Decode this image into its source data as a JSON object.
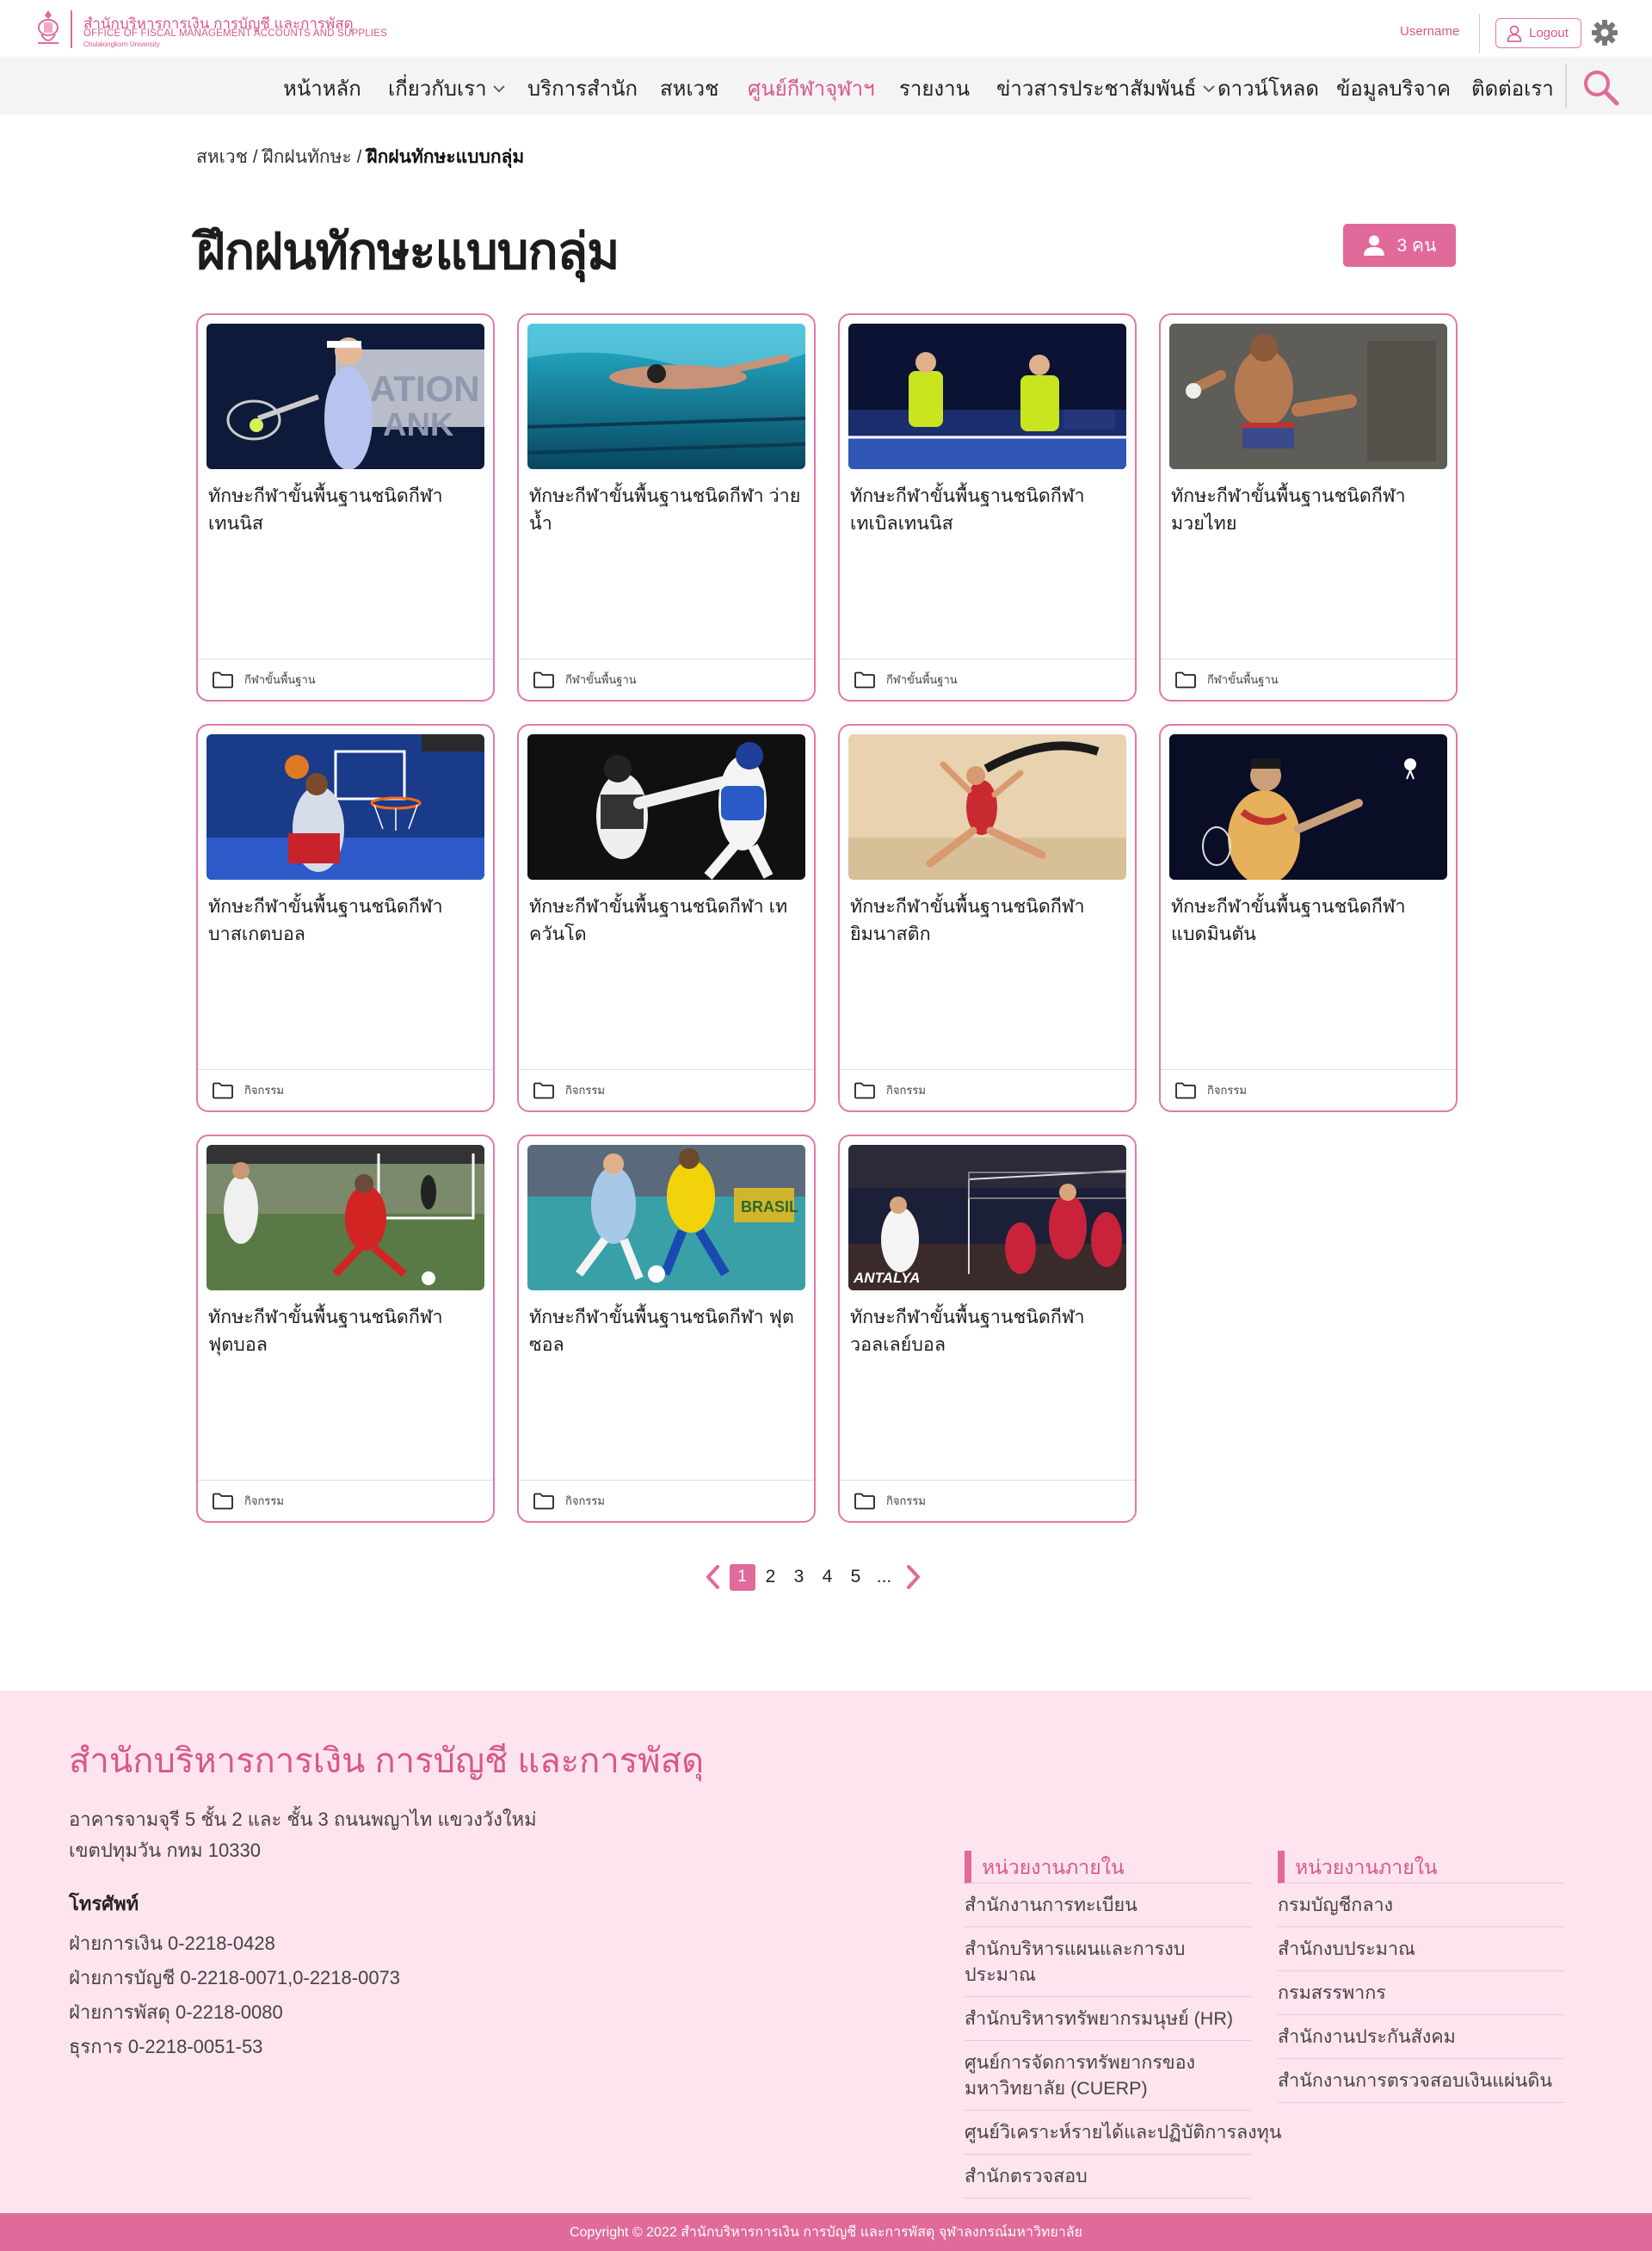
{
  "header": {
    "org_name_th": "สำนักบริหารการเงิน การบัญชี และการพัสดุ",
    "org_name_en": "OFFICE OF FISCAL MANAGEMENT ACCOUNTS AND SUPPLIES",
    "university": "Chulalongkorn University",
    "username": "Username",
    "logout_label": "Logout"
  },
  "nav": {
    "items": [
      {
        "label": "หน้าหลัก"
      },
      {
        "label": "เกี่ยวกับเรา"
      },
      {
        "label": "บริการสำนัก"
      },
      {
        "label": "สหเวช"
      },
      {
        "label": "ศูนย์กีฬาจุฬาฯ"
      },
      {
        "label": "รายงาน"
      },
      {
        "label": "ข่าวสารประชาสัมพันธ์"
      },
      {
        "label": "ดาวน์โหลด"
      },
      {
        "label": "ข้อมูลบริจาค"
      },
      {
        "label": "ติดต่อเรา"
      }
    ]
  },
  "breadcrumb": {
    "items": [
      "สหเวช",
      "ฝึกฝนทักษะ",
      "ฝึกฝนทักษะแบบกลุ่ม"
    ],
    "separator": " / "
  },
  "page": {
    "title": "ฝึกฝนทักษะแบบกลุ่ม",
    "count_label": "3 คน"
  },
  "cards": [
    {
      "title": "ทักษะกีฬาขั้นพื้นฐานชนิดกีฬา เทนนิส",
      "category": "กีฬาขั้นพื้นฐาน",
      "image": "tennis-player-photo"
    },
    {
      "title": "ทักษะกีฬาขั้นพื้นฐานชนิดกีฬา ว่ายน้ำ",
      "category": "กีฬาขั้นพื้นฐาน",
      "image": "swimmer-photo"
    },
    {
      "title": "ทักษะกีฬาขั้นพื้นฐานชนิดกีฬา เทเบิลเทนนิส",
      "category": "กีฬาขั้นพื้นฐาน",
      "image": "table-tennis-photo"
    },
    {
      "title": "ทักษะกีฬาขั้นพื้นฐานชนิดกีฬา มวยไทย",
      "category": "กีฬาขั้นพื้นฐาน",
      "image": "muay-thai-photo"
    },
    {
      "title": "ทักษะกีฬาขั้นพื้นฐานชนิดกีฬา บาสเกตบอล",
      "category": "กิจกรรม",
      "image": "basketball-photo"
    },
    {
      "title": "ทักษะกีฬาขั้นพื้นฐานชนิดกีฬา เทควันโด",
      "category": "กิจกรรม",
      "image": "taekwondo-photo"
    },
    {
      "title": "ทักษะกีฬาขั้นพื้นฐานชนิดกีฬา ยิมนาสติก",
      "category": "กิจกรรม",
      "image": "gymnastics-photo"
    },
    {
      "title": "ทักษะกีฬาขั้นพื้นฐานชนิดกีฬา แบดมินตัน",
      "category": "กิจกรรม",
      "image": "badminton-photo"
    },
    {
      "title": "ทักษะกีฬาขั้นพื้นฐานชนิดกีฬา ฟุตบอล",
      "category": "กิจกรรม",
      "image": "football-photo"
    },
    {
      "title": "ทักษะกีฬาขั้นพื้นฐานชนิดกีฬา ฟุตซอล",
      "category": "กิจกรรม",
      "image": "futsal-photo"
    },
    {
      "title": "ทักษะกีฬาขั้นพื้นฐานชนิดกีฬา วอลเลย์บอล",
      "category": "กิจกรรม",
      "image": "volleyball-photo"
    }
  ],
  "pagination": {
    "pages": [
      "1",
      "2",
      "3",
      "4",
      "5"
    ],
    "current": "1",
    "ellipsis": "..."
  },
  "footer": {
    "title": "สำนักบริหารการเงิน การบัญชี และการพัสดุ",
    "address_line1": "อาคารจามจุรี 5 ชั้น 2 และ ชั้น 3 ถนนพญาไท แขวงวังใหม่",
    "address_line2": "เขตปทุมวัน กทม 10330",
    "phone_heading": "โทรศัพท์",
    "phones": [
      "ฝ่ายการเงิน 0-2218-0428",
      "ฝ่ายการบัญชี 0-2218-0071,0-2218-0073",
      "ฝ่ายการพัสดุ 0-2218-0080",
      "ธุรการ 0-2218-0051-53"
    ],
    "col1_heading": "หน่วยงานภายใน",
    "col1_links": [
      "สำนักงานการทะเบียน",
      "สำนักบริหารแผนและการงบประมาณ",
      "สำนักบริหารทรัพยากรมนุษย์ (HR)",
      "ศูนย์การจัดการทรัพยากรของมหาวิทยาลัย (CUERP)",
      "ศูนย์วิเคราะห์รายได้และปฏิบัติการลงทุน",
      "สำนักตรวจสอบ"
    ],
    "col2_heading": "หน่วยงานภายใน",
    "col2_links": [
      "กรมบัญชีกลาง",
      "สำนักงบประมาณ",
      "กรมสรรพากร",
      "สำนักงานประกันสังคม",
      "สำนักงานการตรวจสอบเงินแผ่นดิน"
    ],
    "copyright": "Copyright © 2022 สำนักบริหารการเงิน การบัญชี และการพัสดุ จุฬาลงกรณ์มหาวิทยาลัย"
  },
  "colors": {
    "accent": "#e06a9a",
    "accent_text": "#d8578d",
    "footer_bg": "#fde4ee",
    "nav_bg": "#f4f4f4"
  },
  "icons": [
    "university-logo",
    "user-icon",
    "gear-icon",
    "chevron-down-icon",
    "search-icon",
    "folder-icon",
    "chevron-left-icon",
    "chevron-right-icon"
  ]
}
